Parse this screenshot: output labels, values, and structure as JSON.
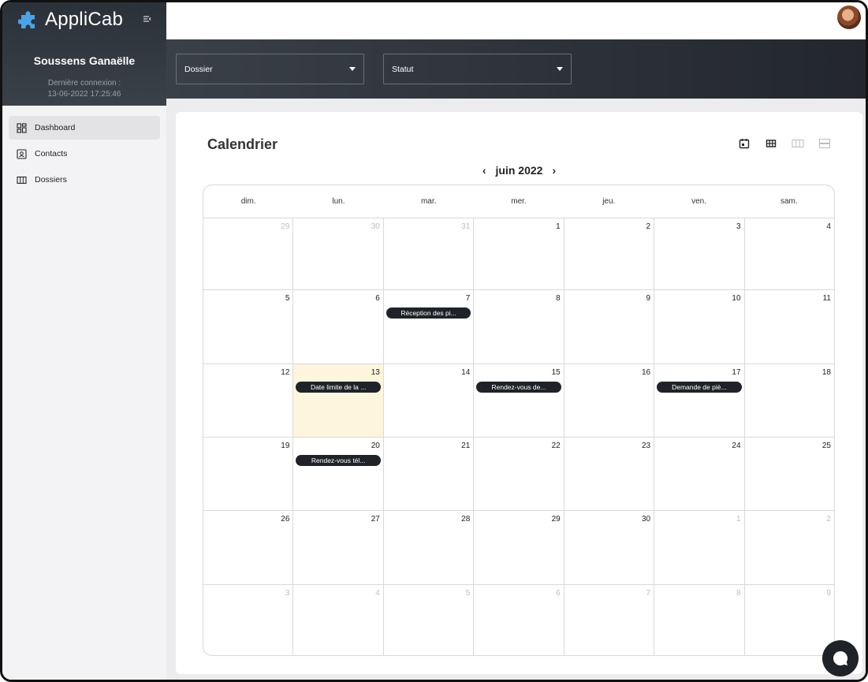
{
  "app": {
    "name": "AppliCab"
  },
  "user": {
    "name": "Soussens Ganaëlle",
    "last_connection_label": "Dernière connexion :",
    "last_connection_value": "13-06-2022 17:25:46"
  },
  "sidebar": {
    "items": [
      {
        "label": "Dashboard",
        "icon": "dashboard-icon",
        "active": true
      },
      {
        "label": "Contacts",
        "icon": "contact-card-icon",
        "active": false
      },
      {
        "label": "Dossiers",
        "icon": "columns-icon",
        "active": false
      }
    ]
  },
  "filters": {
    "dossier": {
      "label": "Dossier"
    },
    "statut": {
      "label": "Statut"
    }
  },
  "calendar": {
    "title": "Calendrier",
    "month_label": "juin 2022",
    "prev_label": "‹",
    "next_label": "›",
    "views": [
      "calendar-icon",
      "month-grid-icon",
      "week-columns-icon",
      "list-rows-icon"
    ],
    "days_of_week": [
      "dim.",
      "lun.",
      "mar.",
      "mer.",
      "jeu.",
      "ven.",
      "sam."
    ],
    "weeks": [
      [
        {
          "n": "29",
          "other": true
        },
        {
          "n": "30",
          "other": true
        },
        {
          "n": "31",
          "other": true
        },
        {
          "n": "1"
        },
        {
          "n": "2"
        },
        {
          "n": "3"
        },
        {
          "n": "4"
        }
      ],
      [
        {
          "n": "5"
        },
        {
          "n": "6"
        },
        {
          "n": "7",
          "event": "Réception des pi..."
        },
        {
          "n": "8"
        },
        {
          "n": "9"
        },
        {
          "n": "10"
        },
        {
          "n": "11"
        }
      ],
      [
        {
          "n": "12"
        },
        {
          "n": "13",
          "today": true,
          "event": "Date limite de la ..."
        },
        {
          "n": "14"
        },
        {
          "n": "15",
          "event": "Rendez-vous de..."
        },
        {
          "n": "16"
        },
        {
          "n": "17",
          "event": "Demande de piè..."
        },
        {
          "n": "18"
        }
      ],
      [
        {
          "n": "19"
        },
        {
          "n": "20",
          "event": "Rendez-vous tél..."
        },
        {
          "n": "21"
        },
        {
          "n": "22"
        },
        {
          "n": "23"
        },
        {
          "n": "24"
        },
        {
          "n": "25"
        }
      ],
      [
        {
          "n": "26"
        },
        {
          "n": "27"
        },
        {
          "n": "28"
        },
        {
          "n": "29"
        },
        {
          "n": "30"
        },
        {
          "n": "1",
          "other": true
        },
        {
          "n": "2",
          "other": true
        }
      ],
      [
        {
          "n": "3",
          "other": true
        },
        {
          "n": "4",
          "other": true
        },
        {
          "n": "5",
          "other": true
        },
        {
          "n": "6",
          "other": true
        },
        {
          "n": "7",
          "other": true
        },
        {
          "n": "8",
          "other": true
        },
        {
          "n": "9",
          "other": true
        }
      ]
    ]
  },
  "colors": {
    "sidebar_header": "#2b3138",
    "filterbar": "#23272d",
    "event_pill": "#1f2329",
    "today_highlight": "#fdf5dc",
    "brand_logo": "#4aa3e8"
  }
}
